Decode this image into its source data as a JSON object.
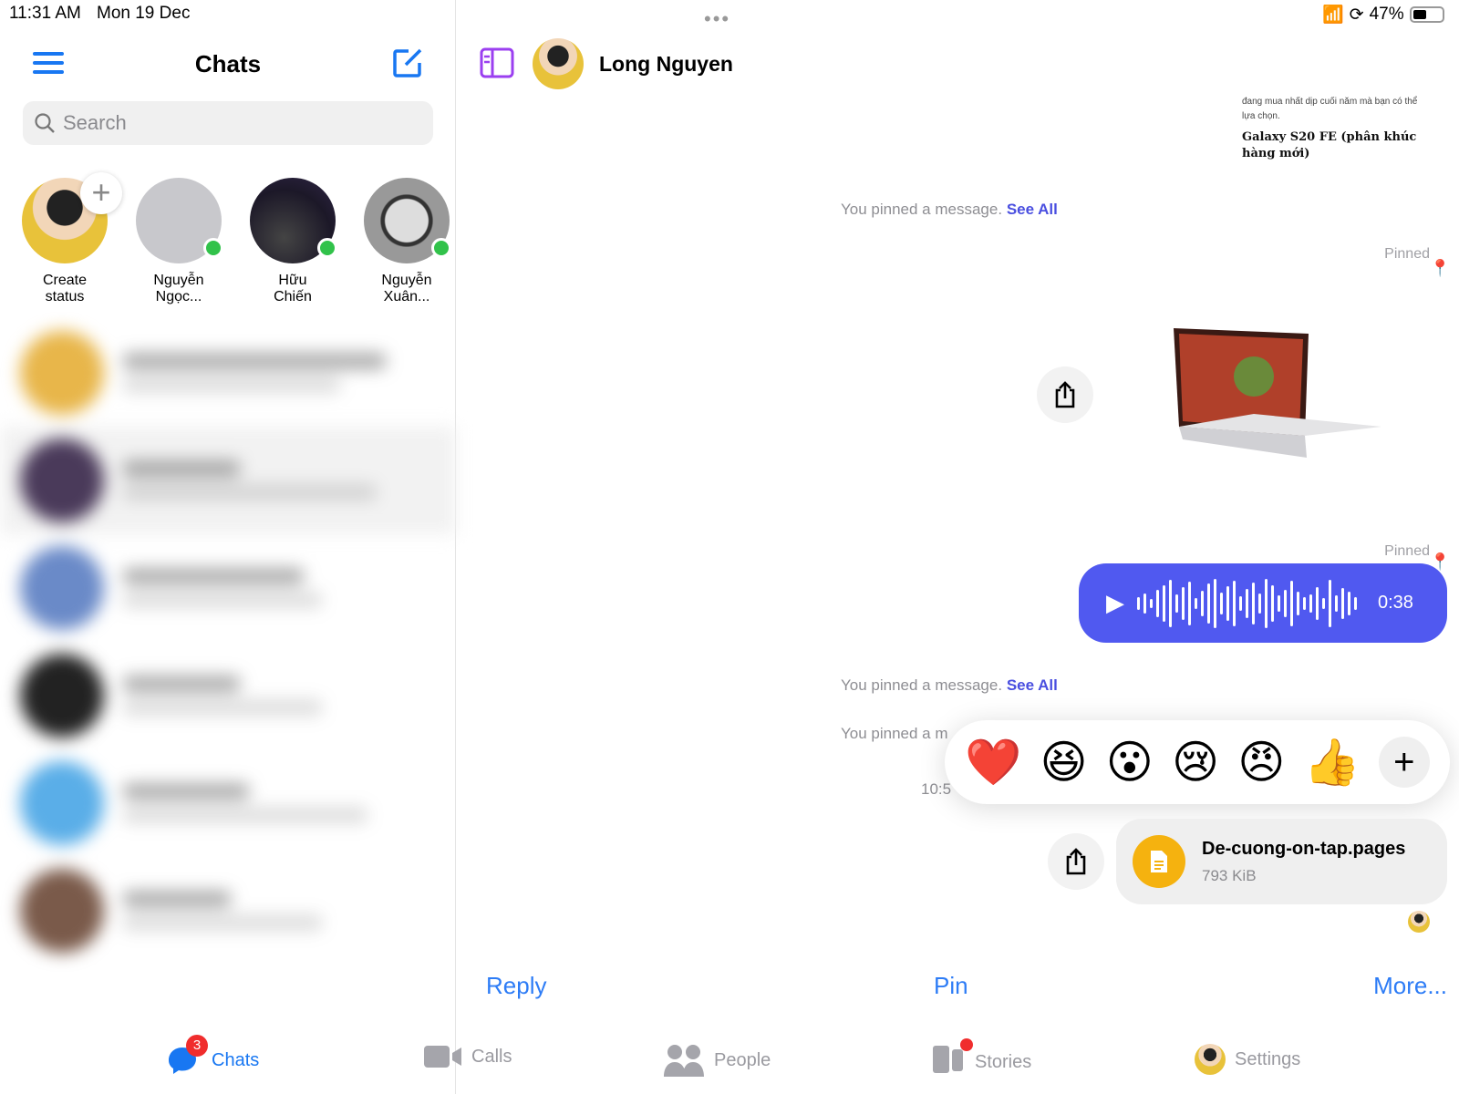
{
  "status_bar": {
    "time": "11:31 AM",
    "date": "Mon 19 Dec",
    "battery": "47%",
    "battery_level": 47
  },
  "sidebar": {
    "title": "Chats",
    "search_placeholder": "Search",
    "stories": [
      {
        "line1": "Create",
        "line2": "status",
        "online": false
      },
      {
        "line1": "Nguyễn",
        "line2": "Ngọc...",
        "online": true
      },
      {
        "line1": "Hữu",
        "line2": "Chiến",
        "online": true
      },
      {
        "line1": "Nguyễn",
        "line2": "Xuân...",
        "online": true
      }
    ]
  },
  "conversation": {
    "name": "Long Nguyen",
    "article": {
      "snippet_1": "đang mua nhất dịp cuối năm mà bạn có thể",
      "snippet_2": "lựa chọn.",
      "heading": "Galaxy S20 FE (phân khúc hàng mới)"
    },
    "system_1": {
      "text": "You pinned a message.",
      "link": "See All"
    },
    "pinned_label": "Pinned",
    "voice": {
      "duration": "0:38"
    },
    "system_2": {
      "text": "You pinned a message.",
      "link": "See All"
    },
    "system_3_partial": "You pinned a m",
    "time_partial": "10:5",
    "reactions": [
      "❤️",
      "😆",
      "😮",
      "😢",
      "😠",
      "👍"
    ],
    "file": {
      "name": "De-cuong-on-tap.pages",
      "size": "793 KiB"
    },
    "actions": {
      "reply": "Reply",
      "pin": "Pin",
      "more": "More..."
    }
  },
  "tabs": [
    {
      "label": "Chats",
      "badge": "3",
      "active": true
    },
    {
      "label": "Calls"
    },
    {
      "label": "People"
    },
    {
      "label": "Stories"
    },
    {
      "label": "Settings"
    }
  ],
  "colors": {
    "accent": "#2d7cf6",
    "voice_bubble": "#5059f0",
    "online": "#31c24a",
    "file_icon": "#f5b20f",
    "badge": "#f02d2d"
  }
}
